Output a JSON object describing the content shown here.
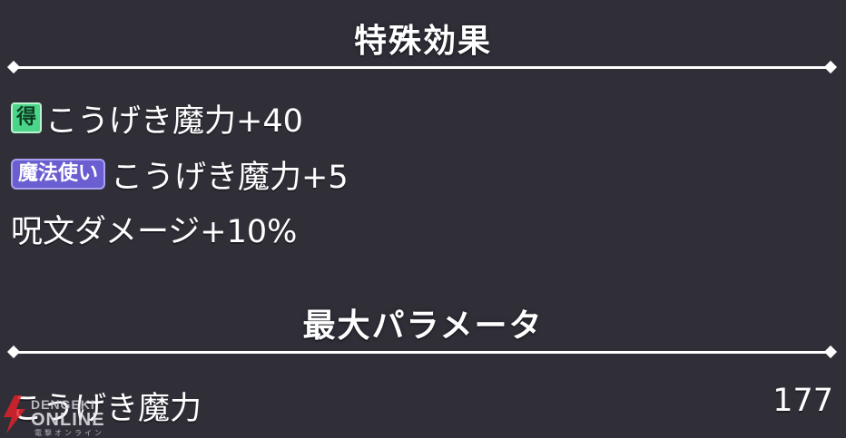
{
  "sections": {
    "special_effects": {
      "title": "特殊効果",
      "items": [
        {
          "badge": "得",
          "badge_color": "#4bd58a",
          "text": "こうげき魔力+40"
        },
        {
          "badge": "魔法使い",
          "badge_color": "#6a5ed0",
          "text": "こうげき魔力+5"
        },
        {
          "badge": "",
          "text": "呪文ダメージ+10%"
        }
      ]
    },
    "max_params": {
      "title": "最大パラメータ",
      "items": [
        {
          "label": "こうげき魔力",
          "value": "177"
        }
      ]
    }
  },
  "watermark": {
    "line1": "DENGEKI",
    "line2": "ONLINE",
    "line3": "電撃オンライン",
    "icon": "lightning-bolt-icon",
    "color": "#e0202a"
  },
  "colors": {
    "background": "#302f38",
    "text": "#ffffff",
    "divider": "#ffffff"
  }
}
